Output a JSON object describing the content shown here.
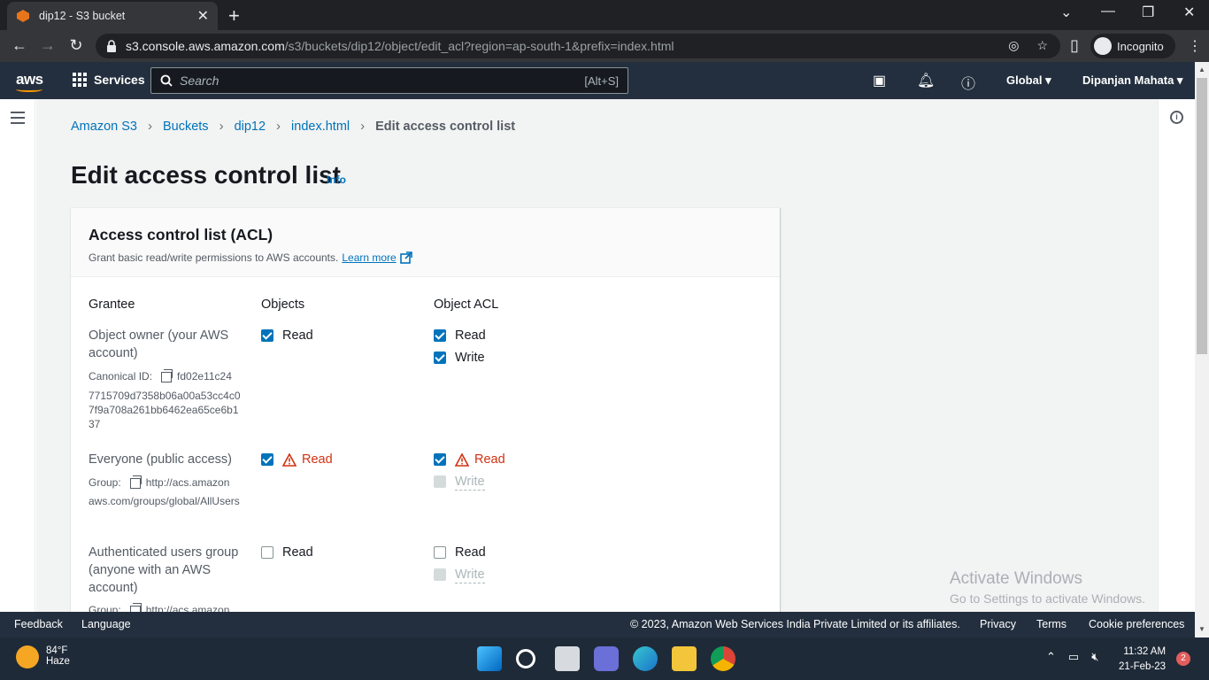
{
  "browser": {
    "tab_title": "dip12 - S3 bucket",
    "url_host": "s3.console.aws.amazon.com",
    "url_path": "/s3/buckets/dip12/object/edit_acl?region=ap-south-1&prefix=index.html",
    "profile_label": "Incognito"
  },
  "awsnav": {
    "services_label": "Services",
    "search_placeholder": "Search",
    "search_shortcut": "[Alt+S]",
    "region_label": "Global",
    "user_label": "Dipanjan Mahata"
  },
  "breadcrumb": {
    "items": [
      "Amazon S3",
      "Buckets",
      "dip12",
      "index.html"
    ],
    "current": "Edit access control list"
  },
  "page": {
    "title": "Edit access control list",
    "info_label": "Info"
  },
  "acl_panel": {
    "title": "Access control list (ACL)",
    "description": "Grant basic read/write permissions to AWS accounts.",
    "learn_more": "Learn more",
    "columns": {
      "grantee": "Grantee",
      "objects": "Objects",
      "object_acl": "Object ACL"
    },
    "rows": [
      {
        "grantee": "Object owner (your AWS account)",
        "id_label": "Canonical ID:",
        "id_first": "fd02e11c24",
        "id_rest": "7715709d7358b06a00a53cc4c07f9a708a261bb6462ea65ce6b137",
        "objects_read": "Read",
        "acl_read": "Read",
        "acl_write": "Write"
      },
      {
        "grantee": "Everyone (public access)",
        "id_label": "Group:",
        "id_first": "http://acs.amazon",
        "id_rest": "aws.com/groups/global/AllUsers",
        "objects_read": "Read",
        "acl_read": "Read",
        "acl_write": "Write"
      },
      {
        "grantee": "Authenticated users group (anyone with an AWS account)",
        "id_label": "Group:",
        "id_first": "http://acs.amazon",
        "objects_read": "Read",
        "acl_read": "Read",
        "acl_write": "Write"
      }
    ]
  },
  "watermark": {
    "line1": "Activate Windows",
    "line2": "Go to Settings to activate Windows."
  },
  "footer": {
    "feedback": "Feedback",
    "language": "Language",
    "copyright": "© 2023, Amazon Web Services India Private Limited or its affiliates.",
    "privacy": "Privacy",
    "terms": "Terms",
    "cookie": "Cookie preferences"
  },
  "taskbar": {
    "temp": "84°F",
    "weather": "Haze",
    "time": "11:32 AM",
    "date": "21-Feb-23",
    "notifications": "2"
  },
  "colors": {
    "aws_nav": "#232f3e",
    "link": "#0073bb",
    "warning": "#d13212",
    "checkbox_checked": "#0073bb"
  }
}
